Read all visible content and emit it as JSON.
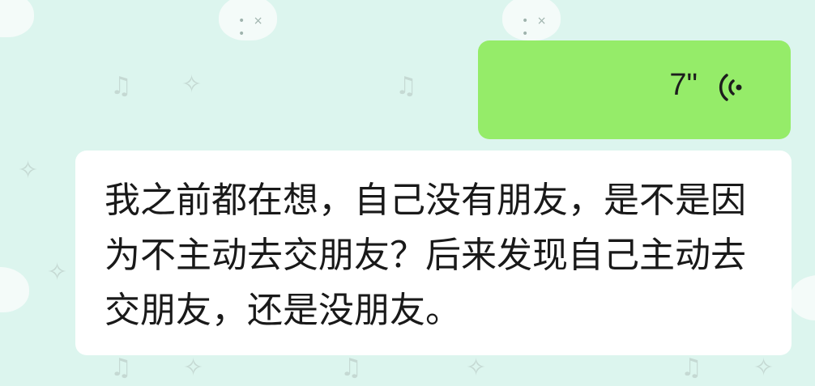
{
  "chat": {
    "outgoing_voice": {
      "duration": "7\"",
      "icon": "voice-wave-icon",
      "bubble_color": "#95ec69"
    },
    "incoming_text": {
      "text": "我之前都在想，自己没有朋友，是不是因为不主动去交朋友？后来发现自己主动去交朋友，还是没朋友。",
      "bubble_color": "#ffffff"
    }
  },
  "background": {
    "color": "#dcf5ee",
    "pattern_icons": [
      "bunny-icon",
      "music-note-icon",
      "sparkle-icon"
    ]
  }
}
